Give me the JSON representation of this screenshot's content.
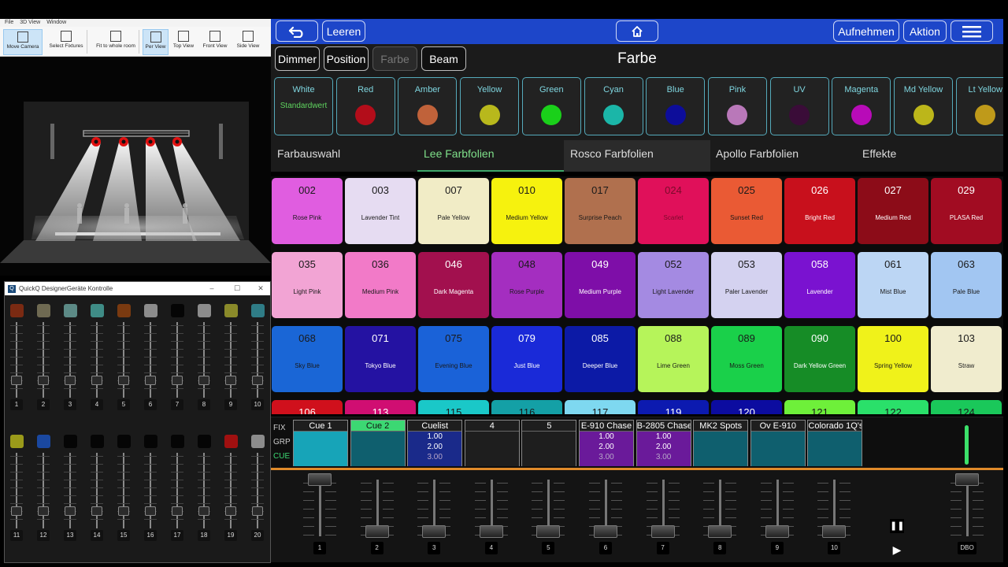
{
  "designer": {
    "menu": [
      "File",
      "3D View",
      "Window"
    ],
    "tools": [
      {
        "label": "Move Camera",
        "icon": "move-camera-icon",
        "active": true
      },
      {
        "label": "Select Fixtures",
        "icon": "select-fixtures-icon",
        "active": false
      },
      {
        "label": "Fit to whole room",
        "icon": "fit-room-icon",
        "active": false
      },
      {
        "label": "Per View",
        "icon": "perspective-view-icon",
        "active": true
      },
      {
        "label": "Top View",
        "icon": "top-view-icon",
        "active": false
      },
      {
        "label": "Front View",
        "icon": "front-view-icon",
        "active": false
      },
      {
        "label": "Side View",
        "icon": "side-view-icon",
        "active": false
      }
    ]
  },
  "fader_window": {
    "title": "QuickQ DesignerGeräte Kontrolle",
    "controls": [
      "–",
      "☐",
      "✕"
    ],
    "bank1": {
      "colors": [
        "#7a2a12",
        "#6f6a52",
        "#5c8a86",
        "#3f8c86",
        "#7a3a10",
        "#8c8c8c",
        "#050505",
        "#8c8c8c",
        "#8a8a2a",
        "#2f7c86"
      ],
      "numbers": [
        "1",
        "2",
        "3",
        "4",
        "5",
        "6",
        "7",
        "8",
        "9",
        "10"
      ]
    },
    "bank2": {
      "colors": [
        "#9a9a1a",
        "#1a48a0",
        "#050505",
        "#050505",
        "#050505",
        "#050505",
        "#050505",
        "#050505",
        "#a01010",
        "#8c8c8c"
      ],
      "numbers": [
        "11",
        "12",
        "13",
        "14",
        "15",
        "16",
        "17",
        "18",
        "19",
        "20"
      ]
    }
  },
  "topbar": {
    "back_icon": "back-arrow-icon",
    "clear_label": "Leeren",
    "home_icon": "home-icon",
    "record_label": "Aufnehmen",
    "action_label": "Aktion",
    "menu_icon": "hamburger-menu-icon"
  },
  "sections": {
    "buttons": [
      "Dimmer",
      "Position",
      "Farbe",
      "Beam"
    ],
    "title": "Farbe"
  },
  "presets": [
    {
      "label": "White",
      "text": "Standardwert",
      "color": null
    },
    {
      "label": "Red",
      "color": "#b30d1a"
    },
    {
      "label": "Amber",
      "color": "#c0623a"
    },
    {
      "label": "Yellow",
      "color": "#b8b81c"
    },
    {
      "label": "Green",
      "color": "#1ad01a"
    },
    {
      "label": "Cyan",
      "color": "#1bb6a8"
    },
    {
      "label": "Blue",
      "color": "#0d0d9a"
    },
    {
      "label": "Pink",
      "color": "#b978b9"
    },
    {
      "label": "UV",
      "color": "#3a0c38"
    },
    {
      "label": "Magenta",
      "color": "#b80bb8"
    },
    {
      "label": "Md Yellow",
      "color": "#bcb61a"
    },
    {
      "label": "Lt Yellow",
      "color": "#bf9a1a"
    }
  ],
  "tabs": [
    "Farbauswahl",
    "Lee Farbfolien",
    "Rosco Farbfolien",
    "Apollo Farbfolien",
    "Effekte"
  ],
  "gels": [
    {
      "num": "002",
      "name": "Rose Pink",
      "bg": "#e05de0",
      "fg": "#1a1a1a"
    },
    {
      "num": "003",
      "name": "Lavender Tint",
      "bg": "#e6dcf2",
      "fg": "#1a1a1a"
    },
    {
      "num": "007",
      "name": "Pale Yellow",
      "bg": "#f1ecc6",
      "fg": "#1a1a1a"
    },
    {
      "num": "010",
      "name": "Medium Yellow",
      "bg": "#f6f20e",
      "fg": "#1a1a1a"
    },
    {
      "num": "017",
      "name": "Surprise Peach",
      "bg": "#b0704e",
      "fg": "#1a1a1a"
    },
    {
      "num": "024",
      "name": "Scarlet",
      "bg": "#e0105a",
      "fg": "#7a0a2a"
    },
    {
      "num": "025",
      "name": "Sunset Red",
      "bg": "#ea5a34",
      "fg": "#1a1a1a"
    },
    {
      "num": "026",
      "name": "Bright Red",
      "bg": "#c8101c",
      "fg": "#ffffff"
    },
    {
      "num": "027",
      "name": "Medium Red",
      "bg": "#8c0c18",
      "fg": "#ffffff"
    },
    {
      "num": "029",
      "name": "PLASA Red",
      "bg": "#a10c22",
      "fg": "#ffffff"
    },
    {
      "num": "035",
      "name": "Light Pink",
      "bg": "#f2a4d4",
      "fg": "#1a1a1a"
    },
    {
      "num": "036",
      "name": "Medium Pink",
      "bg": "#f27ac8",
      "fg": "#1a1a1a"
    },
    {
      "num": "046",
      "name": "Dark Magenta",
      "bg": "#a2104e",
      "fg": "#ffffff"
    },
    {
      "num": "048",
      "name": "Rose Purple",
      "bg": "#a42ec0",
      "fg": "#1a1a1a"
    },
    {
      "num": "049",
      "name": "Medium Purple",
      "bg": "#7e0ea8",
      "fg": "#ffffff"
    },
    {
      "num": "052",
      "name": "Light Lavender",
      "bg": "#a48ae2",
      "fg": "#1a1a1a"
    },
    {
      "num": "053",
      "name": "Paler Lavender",
      "bg": "#d4d2f0",
      "fg": "#1a1a1a"
    },
    {
      "num": "058",
      "name": "Lavender",
      "bg": "#7a12d0",
      "fg": "#ffffff"
    },
    {
      "num": "061",
      "name": "Mist Blue",
      "bg": "#bcd6f4",
      "fg": "#1a1a1a"
    },
    {
      "num": "063",
      "name": "Pale Blue",
      "bg": "#a2c6f2",
      "fg": "#1a1a1a"
    },
    {
      "num": "068",
      "name": "Sky Blue",
      "bg": "#1a66d6",
      "fg": "#1a1a1a"
    },
    {
      "num": "071",
      "name": "Tokyo Blue",
      "bg": "#2412a2",
      "fg": "#ffffff"
    },
    {
      "num": "075",
      "name": "Evening Blue",
      "bg": "#1a62d8",
      "fg": "#1a1a1a"
    },
    {
      "num": "079",
      "name": "Just Blue",
      "bg": "#1a2ad8",
      "fg": "#ffffff"
    },
    {
      "num": "085",
      "name": "Deeper Blue",
      "bg": "#0c1aa6",
      "fg": "#ffffff"
    },
    {
      "num": "088",
      "name": "Lime Green",
      "bg": "#b6f45a",
      "fg": "#1a1a1a"
    },
    {
      "num": "089",
      "name": "Moss Green",
      "bg": "#1ad04a",
      "fg": "#1a1a1a"
    },
    {
      "num": "090",
      "name": "Dark Yellow Green",
      "bg": "#168c26",
      "fg": "#ffffff"
    },
    {
      "num": "100",
      "name": "Spring Yellow",
      "bg": "#f0f21a",
      "fg": "#1a1a1a"
    },
    {
      "num": "103",
      "name": "Straw",
      "bg": "#f0ecce",
      "fg": "#1a1a1a"
    },
    {
      "num": "106",
      "name": "",
      "bg": "#d0101c",
      "fg": "#ffffff"
    },
    {
      "num": "113",
      "name": "",
      "bg": "#d00e72",
      "fg": "#ffffff"
    },
    {
      "num": "115",
      "name": "",
      "bg": "#1ac8c8",
      "fg": "#1a1a1a"
    },
    {
      "num": "116",
      "name": "",
      "bg": "#14a0a6",
      "fg": "#1a1a1a"
    },
    {
      "num": "117",
      "name": "",
      "bg": "#7ed8f0",
      "fg": "#1a1a1a"
    },
    {
      "num": "119",
      "name": "",
      "bg": "#0c1ab0",
      "fg": "#ffffff"
    },
    {
      "num": "120",
      "name": "",
      "bg": "#0c0ca0",
      "fg": "#ffffff"
    },
    {
      "num": "121",
      "name": "",
      "bg": "#6ef03a",
      "fg": "#1a1a1a"
    },
    {
      "num": "122",
      "name": "",
      "bg": "#2ae06a",
      "fg": "#1a1a1a"
    },
    {
      "num": "124",
      "name": "",
      "bg": "#1ac85a",
      "fg": "#1a1a1a"
    }
  ],
  "cue_rows": [
    "FIX",
    "GRP",
    "CUE"
  ],
  "cues": [
    {
      "name": "Cue 1",
      "bg": "#17a4b8",
      "head": "#1e1e1e",
      "values": []
    },
    {
      "name": "Cue 2",
      "bg": "#0f5f6e",
      "head": "#3cd873",
      "values": []
    },
    {
      "name": "Cuelist",
      "bg": "#1a2a8a",
      "head": "#1e1e1e",
      "values": [
        "1.00",
        "2.00",
        "3.00"
      ]
    },
    {
      "name": "4",
      "bg": "#1e1e1e",
      "head": "#1e1e1e",
      "values": []
    },
    {
      "name": "5",
      "bg": "#1e1e1e",
      "head": "#1e1e1e",
      "values": []
    },
    {
      "name": "E-910 Chase",
      "bg": "#6a1a9a",
      "head": "#1e1e1e",
      "values": [
        "1.00",
        "2.00",
        "3.00"
      ]
    },
    {
      "name": "B-2805 Chase",
      "bg": "#6a1a9a",
      "head": "#1e1e1e",
      "values": [
        "1.00",
        "2.00",
        "3.00"
      ]
    },
    {
      "name": "MK2 Spots",
      "bg": "#0f5f6e",
      "head": "#1e1e1e",
      "values": []
    },
    {
      "name": "Ov E-910",
      "bg": "#0f5f6e",
      "head": "#1e1e1e",
      "values": []
    },
    {
      "name": "Colorado 1Q's",
      "bg": "#0f5f6e",
      "head": "#1e1e1e",
      "values": []
    }
  ],
  "playback_faders": {
    "numbers": [
      "1",
      "2",
      "3",
      "4",
      "5",
      "6",
      "7",
      "8",
      "9",
      "10"
    ],
    "levels": [
      1.0,
      0.0,
      0.0,
      0.0,
      0.0,
      0.0,
      0.0,
      0.0,
      0.0,
      0.0
    ],
    "master_label": "DBO",
    "master_level": 1.0,
    "pause_icon": "pause-icon",
    "play_icon": "play-icon"
  }
}
